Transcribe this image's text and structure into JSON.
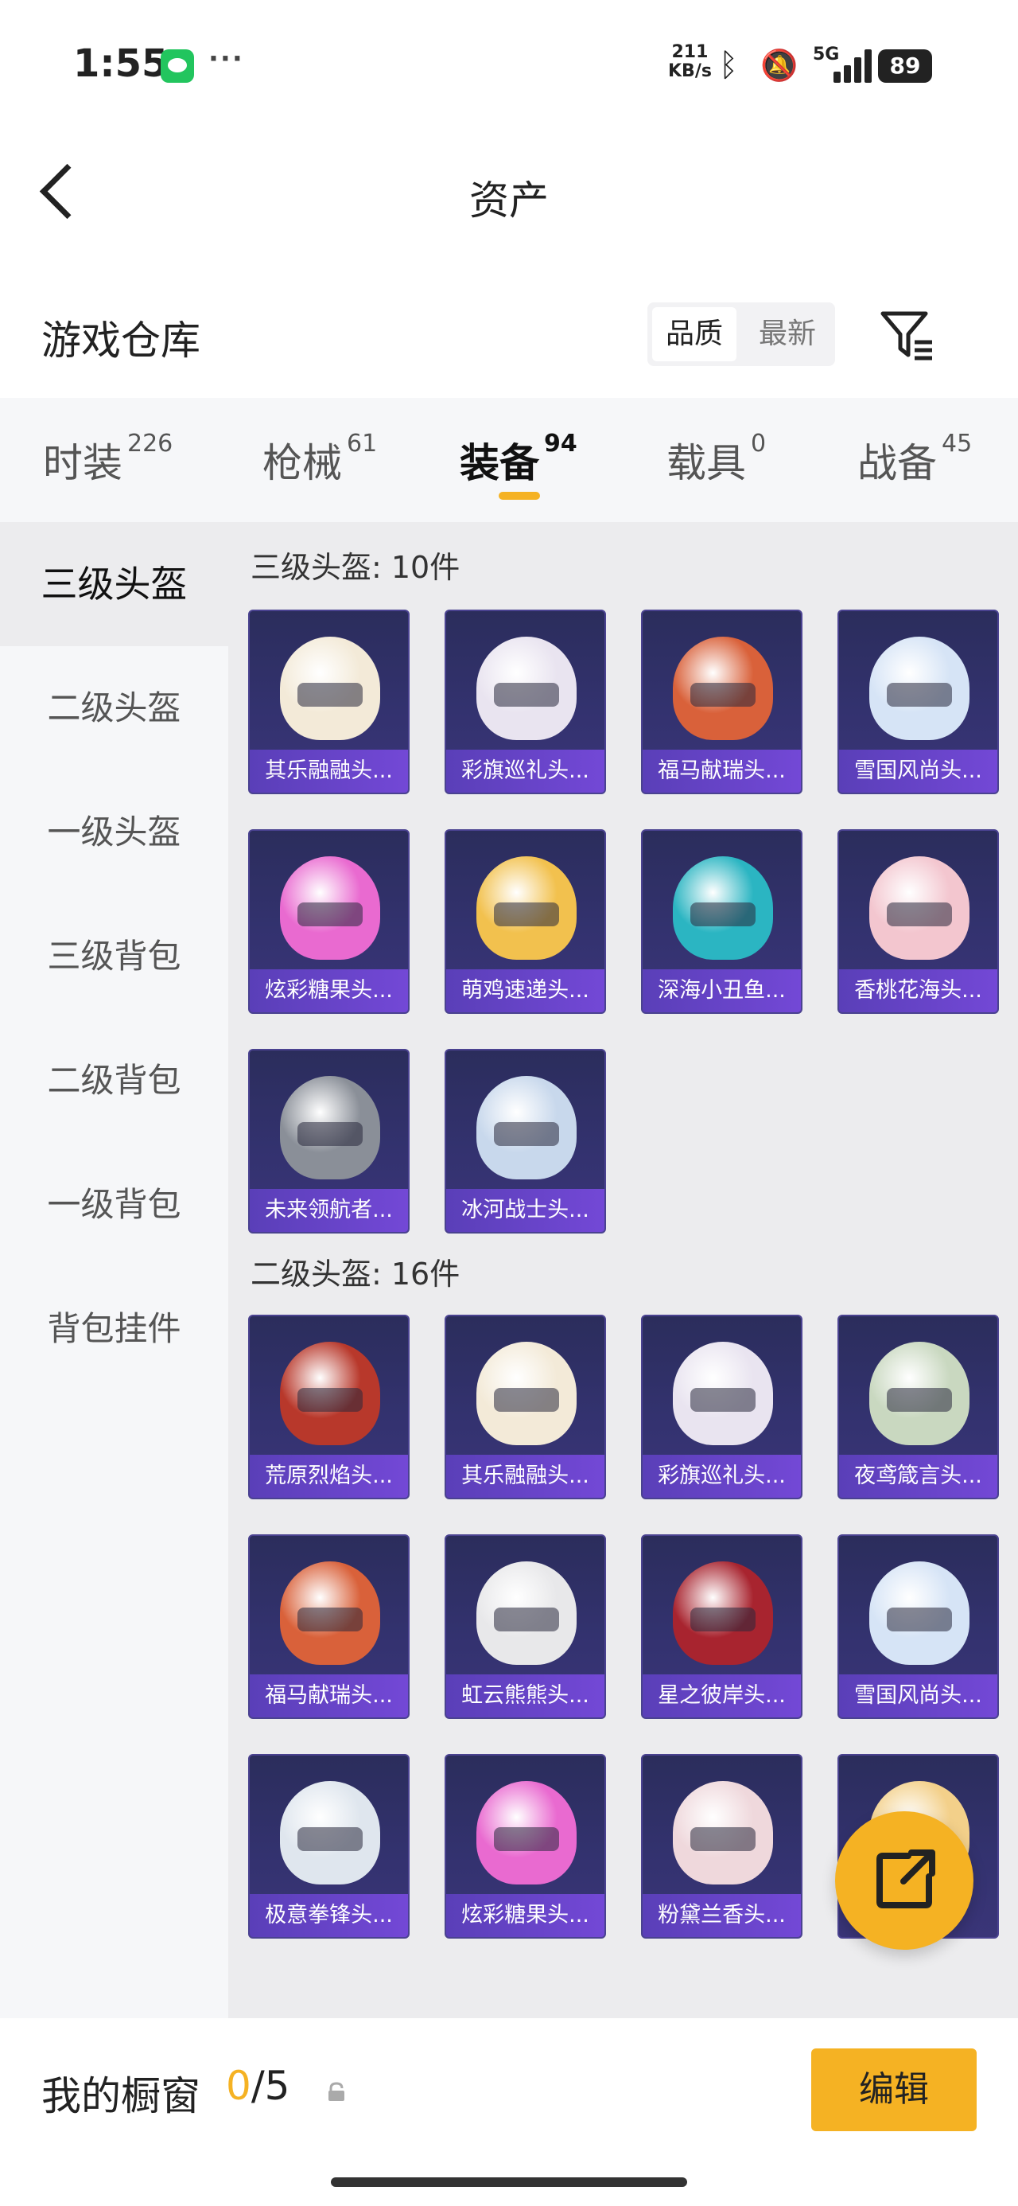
{
  "status_bar": {
    "time": "1:55",
    "more": "···",
    "net_speed_value": "211",
    "net_speed_unit": "KB/s",
    "network": "5G",
    "battery": "89"
  },
  "header": {
    "title": "资产"
  },
  "warehouse": {
    "title": "游戏仓库",
    "sort_quality": "品质",
    "sort_latest": "最新"
  },
  "tabs": [
    {
      "label": "时装",
      "count": "226"
    },
    {
      "label": "枪械",
      "count": "61"
    },
    {
      "label": "装备",
      "count": "94"
    },
    {
      "label": "载具",
      "count": "0"
    },
    {
      "label": "战备",
      "count": "45"
    }
  ],
  "sidebar": {
    "items": [
      {
        "label": "三级头盔"
      },
      {
        "label": "二级头盔"
      },
      {
        "label": "一级头盔"
      },
      {
        "label": "三级背包"
      },
      {
        "label": "二级背包"
      },
      {
        "label": "一级背包"
      },
      {
        "label": "背包挂件"
      }
    ]
  },
  "sections": [
    {
      "title": "三级头盔: 10件",
      "items": [
        {
          "name": "其乐融融头...",
          "color": "#f3ead8"
        },
        {
          "name": "彩旗巡礼头...",
          "color": "#e9e4f0"
        },
        {
          "name": "福马献瑞头...",
          "color": "#d9613a"
        },
        {
          "name": "雪国风尚头...",
          "color": "#d6e4f6"
        },
        {
          "name": "炫彩糖果头...",
          "color": "#e96ad0"
        },
        {
          "name": "萌鸡速递头...",
          "color": "#f2c14e"
        },
        {
          "name": "深海小丑鱼...",
          "color": "#2bb5c2"
        },
        {
          "name": "香桃花海头...",
          "color": "#f3c6cf"
        },
        {
          "name": "未来领航者...",
          "color": "#8a8f98"
        },
        {
          "name": "冰河战士头...",
          "color": "#c8d8ec"
        }
      ]
    },
    {
      "title": "二级头盔: 16件",
      "items": [
        {
          "name": "荒原烈焰头...",
          "color": "#b8382b"
        },
        {
          "name": "其乐融融头...",
          "color": "#f3ead8"
        },
        {
          "name": "彩旗巡礼头...",
          "color": "#e9e4f0"
        },
        {
          "name": "夜鸢箴言头...",
          "color": "#c9d8c0"
        },
        {
          "name": "福马献瑞头...",
          "color": "#d9613a"
        },
        {
          "name": "虹云熊熊头...",
          "color": "#e8e8ea"
        },
        {
          "name": "星之彼岸头...",
          "color": "#a8242f"
        },
        {
          "name": "雪国风尚头...",
          "color": "#d6e4f6"
        },
        {
          "name": "极意拳锋头...",
          "color": "#dfe6ee"
        },
        {
          "name": "炫彩糖果头...",
          "color": "#e96ad0"
        },
        {
          "name": "粉黛兰香头...",
          "color": "#efd8dc"
        },
        {
          "name": "",
          "color": "#f3d08a"
        }
      ]
    }
  ],
  "showcase": {
    "label": "我的橱窗",
    "current": "0",
    "total": "/5",
    "edit": "编辑"
  }
}
